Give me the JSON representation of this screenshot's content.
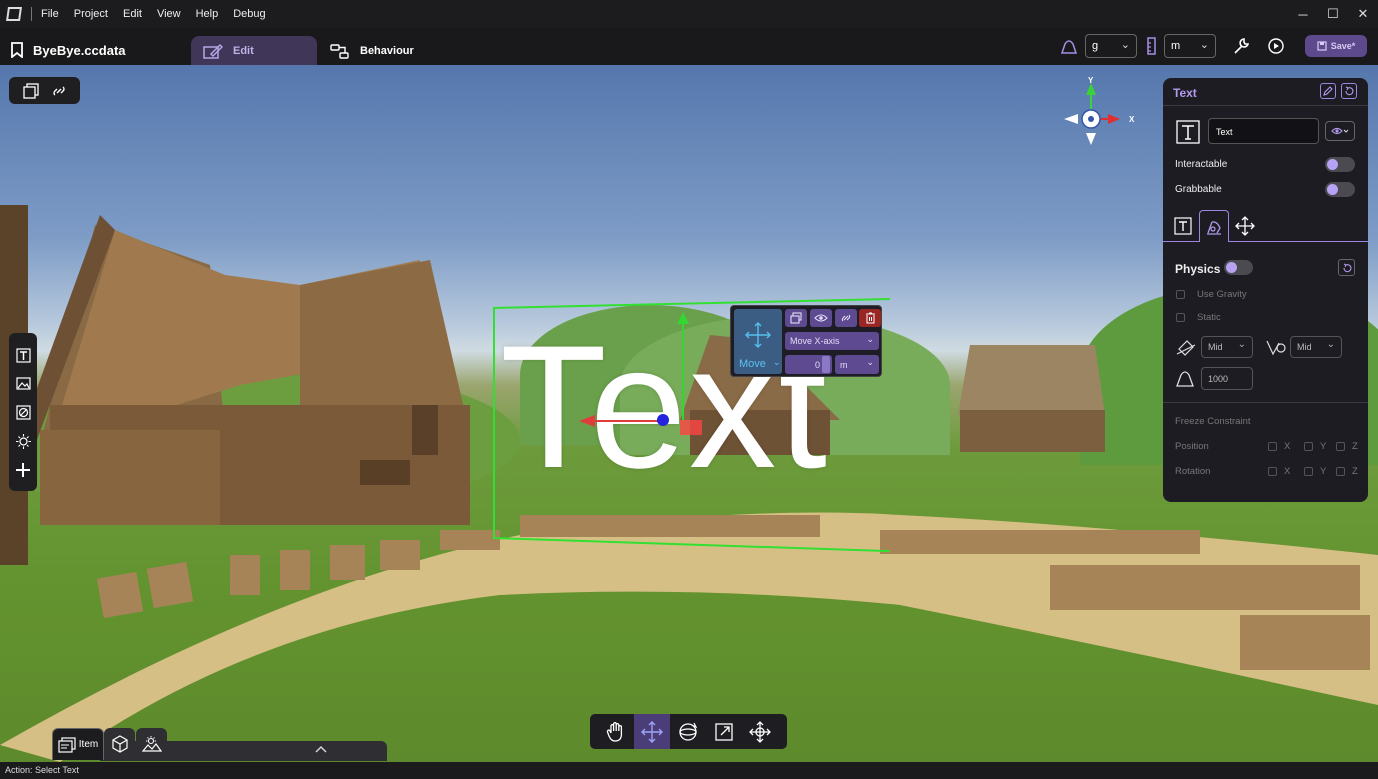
{
  "menu": [
    "File",
    "Project",
    "Edit",
    "View",
    "Help",
    "Debug"
  ],
  "window_controls": {
    "minimize": "─",
    "maximize": "☐",
    "close": "✕"
  },
  "file_name": "ByeBye.ccdata",
  "modes": {
    "edit": "Edit",
    "behaviour": "Behaviour"
  },
  "units": {
    "mass": "g",
    "length": "m"
  },
  "save_label": "Save*",
  "viewport_text": "Text",
  "gizmo": {
    "y": "Y",
    "x": "X"
  },
  "move_popover": {
    "mode": "Move",
    "axis": "Move X-axis",
    "value": "0",
    "unit": "m"
  },
  "panel": {
    "title": "Text",
    "name_value": "Text",
    "interactable": "Interactable",
    "grabbable": "Grabbable",
    "physics": "Physics",
    "use_gravity": "Use Gravity",
    "static": "Static",
    "friction": "Mid",
    "bounce": "Mid",
    "mass": "1000",
    "freeze_constraint": "Freeze Constraint",
    "position": "Position",
    "rotation": "Rotation",
    "axes": [
      "X",
      "Y",
      "Z"
    ],
    "toggles": {
      "interactable": true,
      "grabbable": true,
      "physics": true
    }
  },
  "bottom_tab": "Item",
  "status": "Action: Select Text",
  "colors": {
    "accent": "#b39af0",
    "active_tab": "#3f3658",
    "panel_bg": "#1d1c22",
    "bbox": "#32e032"
  }
}
